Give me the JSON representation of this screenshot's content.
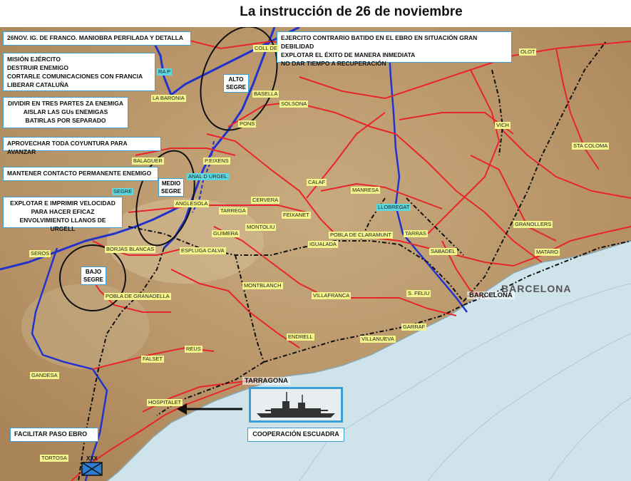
{
  "title": "La instrucción de 26 de noviembre",
  "boxes": {
    "header": "26NOV. IG. DE FRANCO. MANIOBRA PERFILADA Y  DETALLA",
    "mision": [
      "MISIÓN EJÉRCITO",
      "DESTRUIR ENEMIGO",
      "CORTARLE COMUNICACIONES CON FRANCIA",
      "LIBERAR CATALUÑA"
    ],
    "dividir": [
      "DIVIDIR EN TRES PARTES ZA ENEMIGA",
      "AISLAR LAS GUs  ENEMIGAS",
      "BATIRLAS POR SEPARADO"
    ],
    "aprovechar": "APROVECHAR TODA COYUNTURA PARA AVANZAR",
    "mantener": "MANTENER CONTACTO PERMANENTE ENEMIGO",
    "explotar": [
      "EXPLOTAR E IMPRIMIR VELOCIDAD",
      "PARA HACER EFICAZ",
      "ENVOLVIMIENTO LLANOS DE URGELL"
    ],
    "ejercito": [
      "EJERCITO CONTRARIO BATIDO EN EL EBRO EN SITUACIÓN GRAN DEBILIDAD",
      "EXPLOTAR EL ÉXITO DE MANERA INMEDIATA",
      "NO DAR TIEMPO A RECUPERACIÓN"
    ],
    "facilitar": "FACILITAR PASO EBRO",
    "cooperacion": "COOPERACIÓN ESCUADRA"
  },
  "zones": {
    "alto": [
      "ALTO",
      "SEGRE"
    ],
    "medio": [
      "MEDIO",
      "SEGRE"
    ],
    "bajo": [
      "BAJO",
      "SEGRE"
    ]
  },
  "places": [
    {
      "name": "COLL DE",
      "cyan": false
    },
    {
      "name": "OLOT",
      "cyan": false
    },
    {
      "name": "LA BARONIA",
      "cyan": false
    },
    {
      "name": "BASELLA",
      "cyan": false
    },
    {
      "name": "SOLSONA",
      "cyan": false
    },
    {
      "name": "PONS",
      "cyan": false
    },
    {
      "name": "VICH",
      "cyan": false
    },
    {
      "name": "STA COLOMA",
      "cyan": false
    },
    {
      "name": "BALAGUER",
      "cyan": false
    },
    {
      "name": "P.EIXENS",
      "cyan": false
    },
    {
      "name": "ANAL D URGEL",
      "cyan": true
    },
    {
      "name": "SEGRE",
      "cyan": true
    },
    {
      "name": "CALAF",
      "cyan": false
    },
    {
      "name": "MANRESA",
      "cyan": false
    },
    {
      "name": "LLOBREGAT",
      "cyan": true
    },
    {
      "name": "ANGLESOLA",
      "cyan": false
    },
    {
      "name": "CERVERA",
      "cyan": false
    },
    {
      "name": "TARREGA",
      "cyan": false
    },
    {
      "name": "FEIXANET",
      "cyan": false
    },
    {
      "name": "GRANOLLERS",
      "cyan": false
    },
    {
      "name": "MONTOLIU",
      "cyan": false
    },
    {
      "name": "GUIMERA",
      "cyan": false
    },
    {
      "name": "POBLA DE CLARAMUNT",
      "cyan": false
    },
    {
      "name": "TARRAS",
      "cyan": false
    },
    {
      "name": "IGUALADA",
      "cyan": false
    },
    {
      "name": "SABADEL",
      "cyan": false
    },
    {
      "name": "MATARO",
      "cyan": false
    },
    {
      "name": "SEROS",
      "cyan": false
    },
    {
      "name": "BORJAS BLANCAS",
      "cyan": false
    },
    {
      "name": "ESPLUGA CALVA",
      "cyan": false
    },
    {
      "name": "MONTBLANCH",
      "cyan": false
    },
    {
      "name": "VILLAFRANCA",
      "cyan": false
    },
    {
      "name": "S. FELIU",
      "cyan": false
    },
    {
      "name": "POBLA DE GRANADELLA",
      "cyan": false
    },
    {
      "name": "GARRAF",
      "cyan": false
    },
    {
      "name": "ENDRELL",
      "cyan": false
    },
    {
      "name": "VILLANUEVA",
      "cyan": false
    },
    {
      "name": "REUS",
      "cyan": false
    },
    {
      "name": "FALSET",
      "cyan": false
    },
    {
      "name": "GANDESA",
      "cyan": false
    },
    {
      "name": "HOSPITALET",
      "cyan": false
    },
    {
      "name": "TORTOSA",
      "cyan": false
    },
    {
      "name": "RA P",
      "cyan": true
    }
  ],
  "cities": {
    "barcelona": "BARCELONA",
    "tarragona": "TARRAGONA",
    "barcelona_map": "BARCELONA"
  },
  "icons": {
    "ship": "battleship-icon",
    "unit": "army-unit-symbol-icon",
    "arrow": "arrow-left-icon"
  },
  "colors": {
    "box_border": "#3aa0d8",
    "road": "#e8252a",
    "river": "#2233cc",
    "rail": "#111111",
    "sea": "#cfe3ea",
    "land": "#c9a878"
  }
}
